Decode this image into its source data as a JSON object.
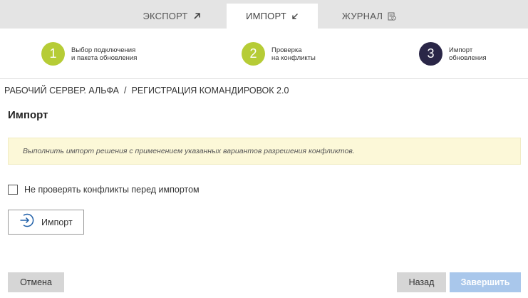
{
  "tabs": [
    {
      "label": "ЭКСПОРТ",
      "icon": "arrow-up-right-icon",
      "active": false
    },
    {
      "label": "ИМПОРТ",
      "icon": "arrow-down-left-icon",
      "active": true
    },
    {
      "label": "ЖУРНАЛ",
      "icon": "log-clock-icon",
      "active": false
    }
  ],
  "steps": [
    {
      "number": "1",
      "line1": "Выбор подключения",
      "line2": "и пакета обновления",
      "state": "done"
    },
    {
      "number": "2",
      "line1": "Проверка",
      "line2": "на конфликты",
      "state": "done"
    },
    {
      "number": "3",
      "line1": "Импорт",
      "line2": "обновления",
      "state": "current"
    }
  ],
  "breadcrumb": {
    "server": "РАБОЧИЙ СЕРВЕР. АЛЬФА",
    "separator": "/",
    "package": "РЕГИСТРАЦИЯ КОМАНДИРОВОК 2.0"
  },
  "page_title": "Импорт",
  "info_message": "Выполнить импорт решения с применением указанных вариантов разрешения конфликтов.",
  "skip_check": {
    "label": "Не проверять конфликты перед импортом",
    "checked": false
  },
  "import_button": {
    "label": "Импорт",
    "icon": "arrow-into-circle-icon"
  },
  "footer": {
    "cancel_label": "Отмена",
    "back_label": "Назад",
    "finish_label": "Завершить"
  },
  "colors": {
    "step_done": "#b6cc36",
    "step_current": "#2a2647",
    "info_bg": "#fcf8d8",
    "finish_disabled": "#a9c7eb"
  }
}
